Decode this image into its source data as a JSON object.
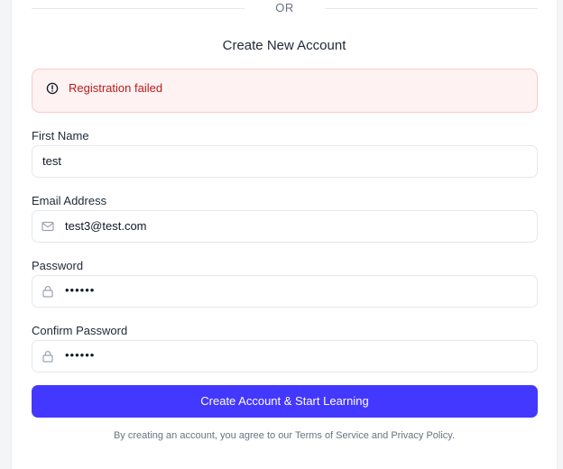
{
  "divider": {
    "text": "OR"
  },
  "form": {
    "title": "Create New Account",
    "error": {
      "message": "Registration failed",
      "icon": "alert-circle-icon"
    },
    "first_name": {
      "label": "First Name",
      "value": "test"
    },
    "email": {
      "label": "Email Address",
      "value": "test3@test.com",
      "icon": "mail-icon"
    },
    "password": {
      "label": "Password",
      "value": "••••••",
      "icon": "lock-icon"
    },
    "confirm_password": {
      "label": "Confirm Password",
      "value": "••••••",
      "icon": "lock-icon"
    },
    "submit_label": "Create Account & Start Learning",
    "terms": "By creating an account, you agree to our Terms of Service and Privacy Policy."
  },
  "colors": {
    "accent": "#4338ff",
    "error_bg": "#fef2f2",
    "error_text": "#b91c1c"
  }
}
